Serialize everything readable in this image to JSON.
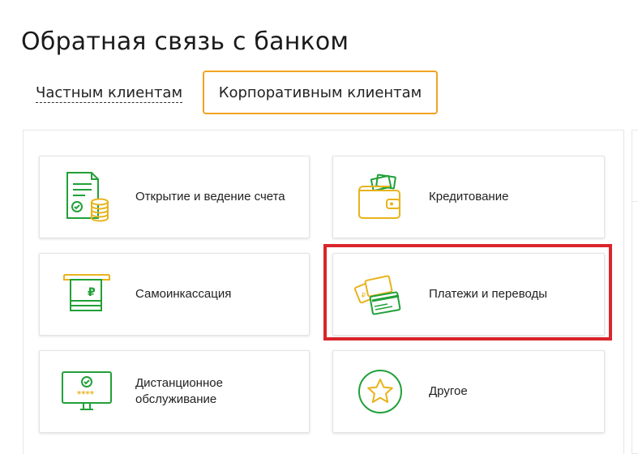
{
  "page": {
    "title": "Обратная связь с банком"
  },
  "tabs": {
    "private": "Частным клиентам",
    "corporate": "Корпоративным клиентам"
  },
  "cards": [
    {
      "label": "Открытие и ведение счета",
      "icon": "document-coins-icon"
    },
    {
      "label": "Кредитование",
      "icon": "wallet-icon"
    },
    {
      "label": "Самоинкассация",
      "icon": "atm-cash-icon"
    },
    {
      "label": "Платежи и переводы",
      "icon": "cards-payment-icon"
    },
    {
      "label": "Дистанционное обслуживание",
      "icon": "monitor-icon"
    },
    {
      "label": "Другое",
      "icon": "star-icon"
    }
  ],
  "colors": {
    "accent": "#f2a221",
    "green": "#21a038",
    "gold": "#e8b31c",
    "highlight": "#d9252b"
  }
}
